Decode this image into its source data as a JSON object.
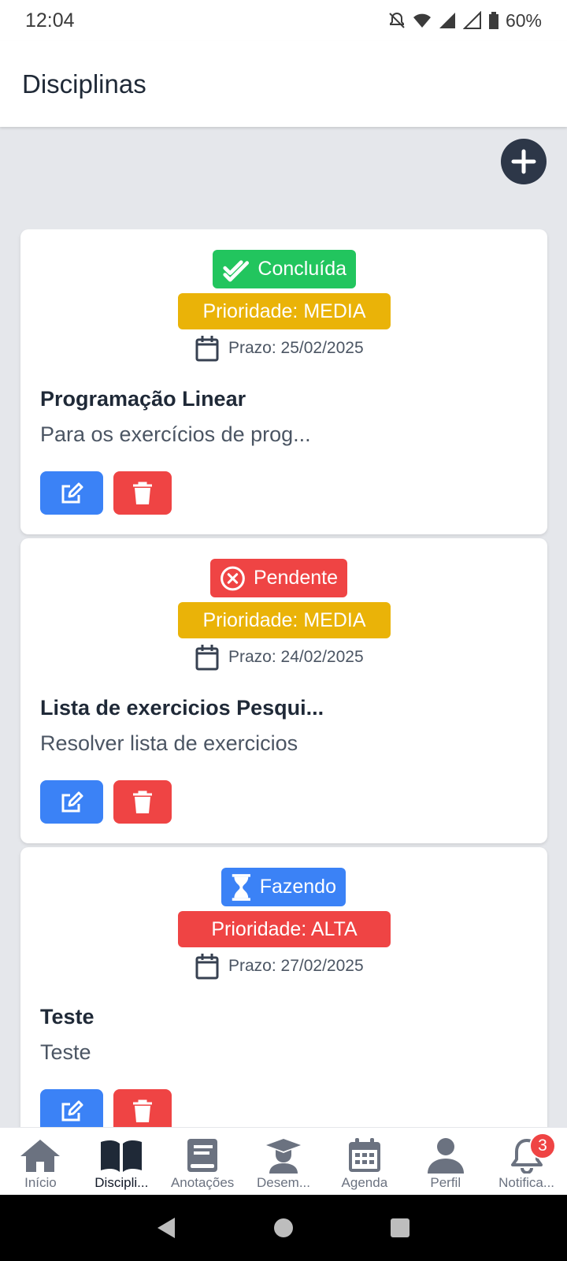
{
  "status_bar": {
    "time": "12:04",
    "battery": "60%",
    "icons": [
      "mute-icon",
      "wifi-icon",
      "signal-icon",
      "signal-empty-icon",
      "battery-icon"
    ]
  },
  "header": {
    "title": "Disciplinas"
  },
  "add_button": {
    "icon": "plus-icon"
  },
  "cards": [
    {
      "status": "Concluída",
      "status_icon": "check-double-icon",
      "status_color": "#22c55e",
      "priority": "Prioridade: MEDIA",
      "priority_color": "#eab308",
      "deadline": "Prazo: 25/02/2025",
      "title": "Programação Linear",
      "description": "Para os exercícios de prog..."
    },
    {
      "status": "Pendente",
      "status_icon": "x-circle-icon",
      "status_color": "#ef4444",
      "priority": "Prioridade: MEDIA",
      "priority_color": "#eab308",
      "deadline": "Prazo: 24/02/2025",
      "title": "Lista de exercicios Pesqui...",
      "description": "Resolver lista de exercicios"
    },
    {
      "status": "Fazendo",
      "status_icon": "hourglass-icon",
      "status_color": "#3b82f6",
      "priority": "Prioridade: ALTA",
      "priority_color": "#ef4444",
      "deadline": "Prazo: 27/02/2025",
      "title": "Teste",
      "description": "Teste"
    }
  ],
  "bottom_nav": {
    "items": [
      {
        "label": "Início",
        "icon": "home-icon"
      },
      {
        "label": "Discipli...",
        "icon": "book-open-icon",
        "active": true
      },
      {
        "label": "Anotações",
        "icon": "notebook-icon"
      },
      {
        "label": "Desem...",
        "icon": "graduate-icon"
      },
      {
        "label": "Agenda",
        "icon": "calendar-icon"
      },
      {
        "label": "Perfil",
        "icon": "user-icon"
      },
      {
        "label": "Notifica...",
        "icon": "bell-icon",
        "badge": "3"
      }
    ]
  }
}
